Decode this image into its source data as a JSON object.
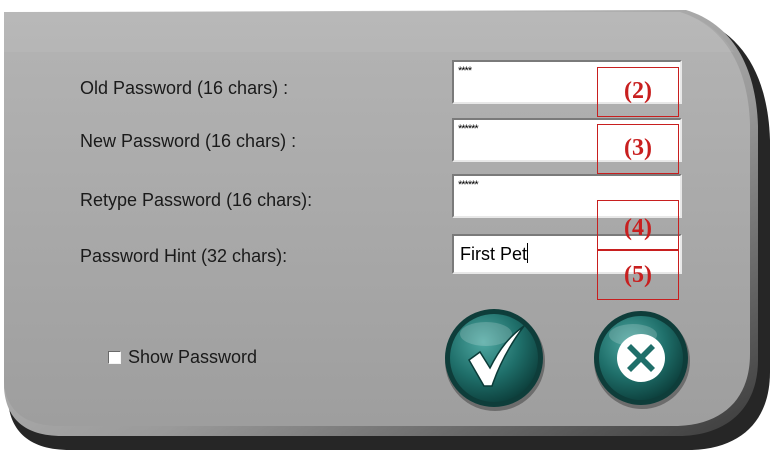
{
  "dialog": {
    "old_password": {
      "label": "Old Password (16 chars) :",
      "value": "****",
      "callout": "(2)"
    },
    "new_password": {
      "label": "New Password (16 chars) :",
      "value": "******",
      "callout": "(3)"
    },
    "retype_password": {
      "label": "Retype Password (16 chars):",
      "value": "******",
      "callout": "(4)"
    },
    "password_hint": {
      "label": "Password Hint (32 chars):",
      "value": "First Pet",
      "callout": "(5)"
    },
    "show_password": {
      "label": "Show Password",
      "checked": false
    },
    "ok_button": {
      "icon": "checkmark-icon"
    },
    "cancel_button": {
      "icon": "close-x-icon"
    }
  },
  "colors": {
    "panel": "#a8a8a8",
    "panel_shadow": "#2a2a2a",
    "button_teal": "#1f6f6a",
    "button_ring": "#0e3d3a",
    "callout_red": "#c81f1f"
  }
}
